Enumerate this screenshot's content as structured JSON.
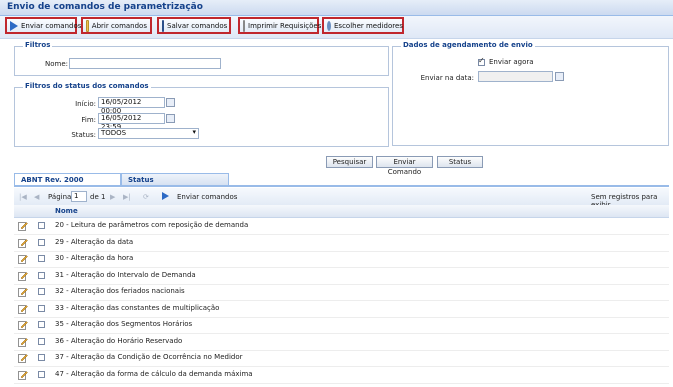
{
  "window": {
    "title": "Envio de comandos de parametrização"
  },
  "toolbar": {
    "buttons": [
      {
        "label": "Enviar comandos",
        "icon": "send-arrow-icon"
      },
      {
        "label": "Abrir comandos",
        "icon": "folder-icon"
      },
      {
        "label": "Salvar comandos",
        "icon": "save-icon"
      },
      {
        "label": "Imprimir Requisições",
        "icon": "print-icon"
      },
      {
        "label": "Escolher medidores",
        "icon": "magnifier-icon"
      }
    ]
  },
  "filtros": {
    "legend": "Filtros",
    "nome_label": "Nome:",
    "nome_value": ""
  },
  "status_filtros": {
    "legend": "Filtros do status dos comandos",
    "inicio_label": "Início:",
    "inicio_value": "16/05/2012 00:00",
    "fim_label": "Fim:",
    "fim_value": "16/05/2012 23:59",
    "status_label": "Status:",
    "status_value": "TODOS"
  },
  "agendamento": {
    "legend": "Dados de agendamento de envio",
    "enviar_agora_label": "Enviar agora",
    "enviar_agora_checked": true,
    "enviar_data_label": "Enviar na data:",
    "enviar_data_value": ""
  },
  "actions": {
    "pesquisar": "Pesquisar",
    "enviar_comando": "Enviar Comando",
    "status": "Status"
  },
  "tabs": [
    {
      "label": "ABNT Rev. 2000",
      "active": true
    },
    {
      "label": "Status",
      "active": false
    }
  ],
  "pager": {
    "page_label": "Página",
    "page_value": "1",
    "of_label": "de 1",
    "send_label": "Enviar comandos",
    "empty_msg": "Sem registros para exibir"
  },
  "grid": {
    "column_name": "Nome",
    "rows": [
      "20 - Leitura de parâmetros com reposição de demanda",
      "29 - Alteração da data",
      "30 - Alteração da hora",
      "31 - Alteração do Intervalo de Demanda",
      "32 - Alteração dos feriados nacionais",
      "33 - Alteração das constantes de multiplicação",
      "35 - Alteração dos Segmentos Horários",
      "36 - Alteração do Horário Reservado",
      "37 - Alteração da Condição de Ocorrência no Medidor",
      "47 - Alteração da forma de cálculo da demanda máxima"
    ]
  },
  "colors": {
    "header_blue": "#15428b",
    "highlight_red": "#c0272d",
    "border_blue": "#99bbe8"
  }
}
